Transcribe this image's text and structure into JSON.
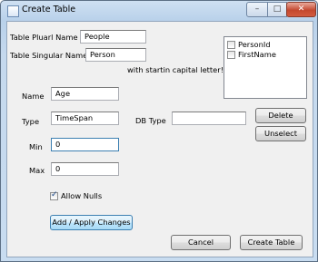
{
  "window": {
    "title": "Create Table",
    "minimize_glyph": "–",
    "maximize_glyph": "□",
    "close_glyph": "✕"
  },
  "form": {
    "plural_label": "Table Pluarl Name",
    "plural_value": "People",
    "singular_label": "Table Singular Name",
    "singular_value": "Person",
    "hint": "with startin capital letter! :D",
    "name_label": "Name",
    "name_value": "Age",
    "type_label": "Type",
    "type_value": "TimeSpan",
    "dbtype_label": "DB Type",
    "dbtype_value": "",
    "min_label": "Min",
    "min_value": "0",
    "max_label": "Max",
    "max_value": "0",
    "allow_nulls_label": "Allow Nulls",
    "allow_nulls_checked": true
  },
  "columns_list": {
    "items": [
      {
        "label": "PersonId",
        "checked": false
      },
      {
        "label": "FirstName",
        "checked": false
      }
    ]
  },
  "buttons": {
    "delete": "Delete",
    "unselect": "Unselect",
    "add_apply": "Add / Apply Changes",
    "cancel": "Cancel",
    "create_table": "Create Table"
  },
  "colors": {
    "accent": "#3c7fb1",
    "close_button": "#c4482f"
  }
}
